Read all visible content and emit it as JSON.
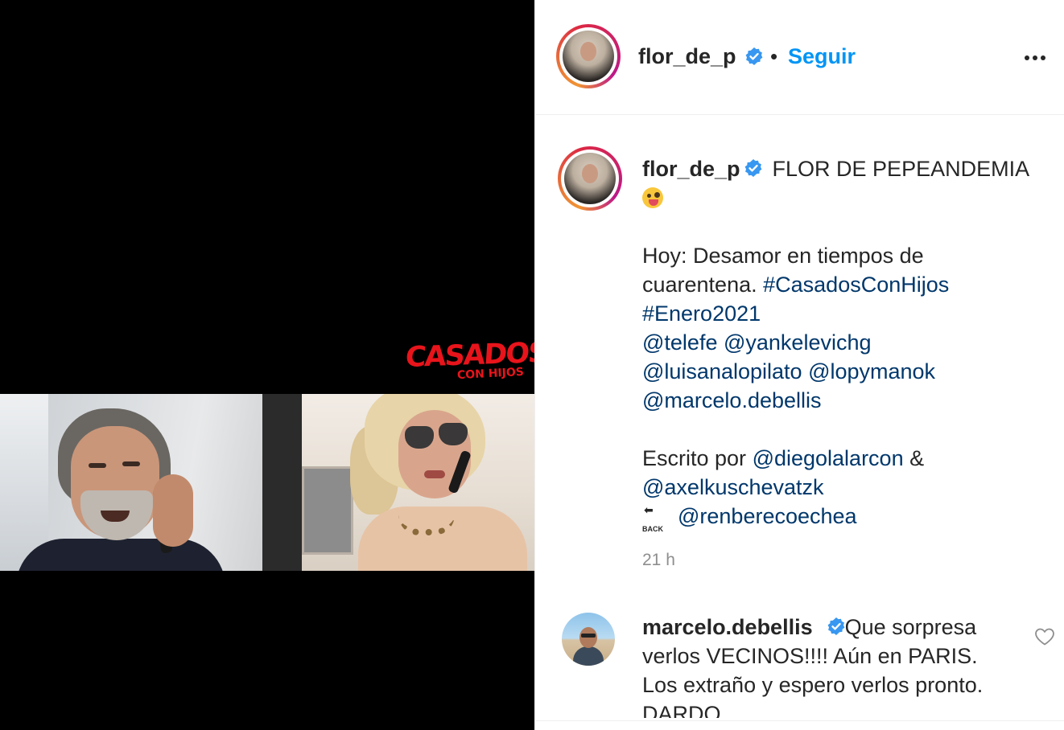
{
  "media": {
    "logo_main": "CASADOS",
    "logo_sub": "CON HIJOS"
  },
  "header": {
    "username": "flor_de_p",
    "dot": "•",
    "follow_label": "Seguir"
  },
  "caption": {
    "username": "flor_de_p",
    "title": "FLOR DE PEPEANDEMIA",
    "line1": "Hoy: Desamor en tiempos de",
    "line2_text": "cuarentena.",
    "hashtag1": "#CasadosConHijos",
    "hashtag2": "#Enero2021",
    "mention_telefe": "@telefe",
    "mention_yankelevichg": "@yankelevichg",
    "mention_luisanalopilato": "@luisanalopilato",
    "mention_lopymanok": "@lopymanok",
    "mention_marcelo": "@marcelo.debellis",
    "written_by": "Escrito por",
    "mention_diego": "@diegolalarcon",
    "amp": "&",
    "mention_axel": "@axelkuschevatzk",
    "back_icon_text": "BACK",
    "mention_ren": "@renberecoechea",
    "emoji": "winking-tongue-emoji"
  },
  "timestamp": "21 h",
  "comment": {
    "username": "marcelo.debellis",
    "text_first": "Que sorpresa",
    "line2": "verlos VECINOS!!!! Aún en PARIS.",
    "line3": "Los extraño y espero verlos pronto.",
    "line4": "DARDO"
  },
  "colors": {
    "link": "#00376b",
    "follow": "#0095f6",
    "verified": "#3897f0",
    "logo_red": "#e8141b"
  }
}
